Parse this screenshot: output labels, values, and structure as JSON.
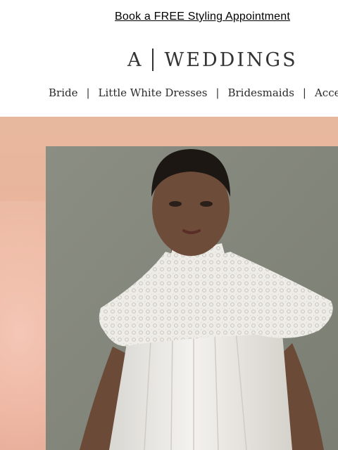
{
  "promo": {
    "link_text": "Book a FREE Styling Appointment"
  },
  "logo": {
    "mark": "A",
    "word": "WEDDINGS"
  },
  "nav": {
    "items": [
      {
        "label": "Bride"
      },
      {
        "label": "Little White Dresses"
      },
      {
        "label": "Bridesmaids"
      },
      {
        "label": "Acces"
      }
    ],
    "separator": "|"
  },
  "hero": {
    "image_alt": "Model in white lace-sleeved wedding dress",
    "background_color": "#e8b19a",
    "photo_background": "#84877c"
  }
}
